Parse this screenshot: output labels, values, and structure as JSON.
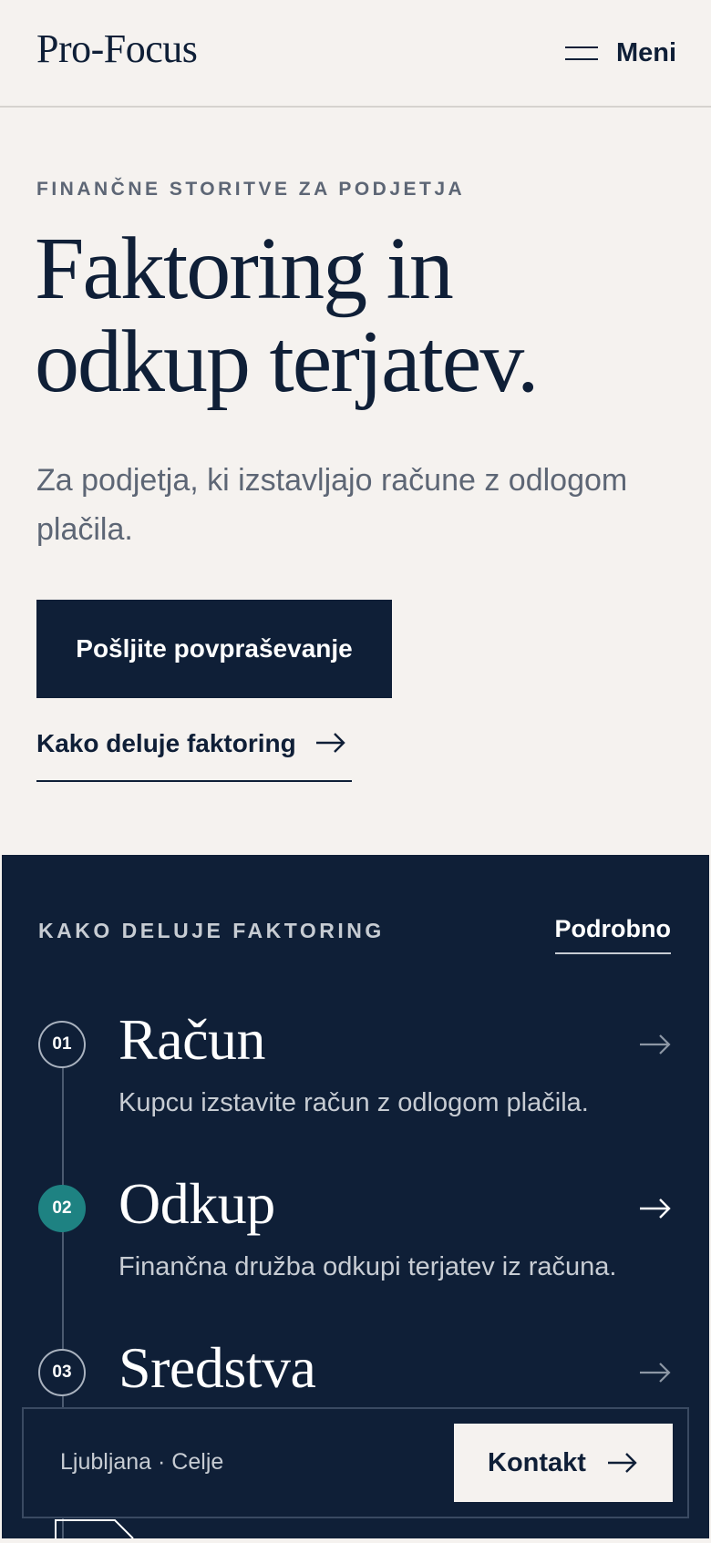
{
  "header": {
    "logo": "Pro-Focus",
    "menu_label": "Meni",
    "menu_icon": "hamburger-icon"
  },
  "hero": {
    "eyebrow": "FINANČNE STORITVE ZA PODJETJA",
    "headline_line1": "Faktoring in",
    "headline_line2": "odkup terjatev.",
    "subtitle": "Za podjetja, ki izstavljajo račune z odlogom plačila.",
    "cta_label": "Pošljite povpraševanje",
    "link_label": "Kako deluje faktoring",
    "link_icon": "arrow-right-icon"
  },
  "process": {
    "eyebrow": "KAKO DELUJE FAKTORING",
    "detail_link": "Podrobno",
    "steps": [
      {
        "num": "01",
        "title": "Račun",
        "desc": "Kupcu izstavite račun z odlogom plačila.",
        "active": false
      },
      {
        "num": "02",
        "title": "Odkup",
        "desc": "Finančna družba odkupi terjatev iz računa.",
        "active": true
      },
      {
        "num": "03",
        "title": "Sredstva",
        "desc": "",
        "active": false
      }
    ]
  },
  "bottom_bar": {
    "locations": "Ljubljana · Celje",
    "contact_label": "Kontakt",
    "contact_icon": "arrow-right-icon"
  },
  "colors": {
    "navy": "#0f1f37",
    "cream": "#f5f2ef",
    "teal": "#1e8282",
    "muted": "#5d6675"
  }
}
